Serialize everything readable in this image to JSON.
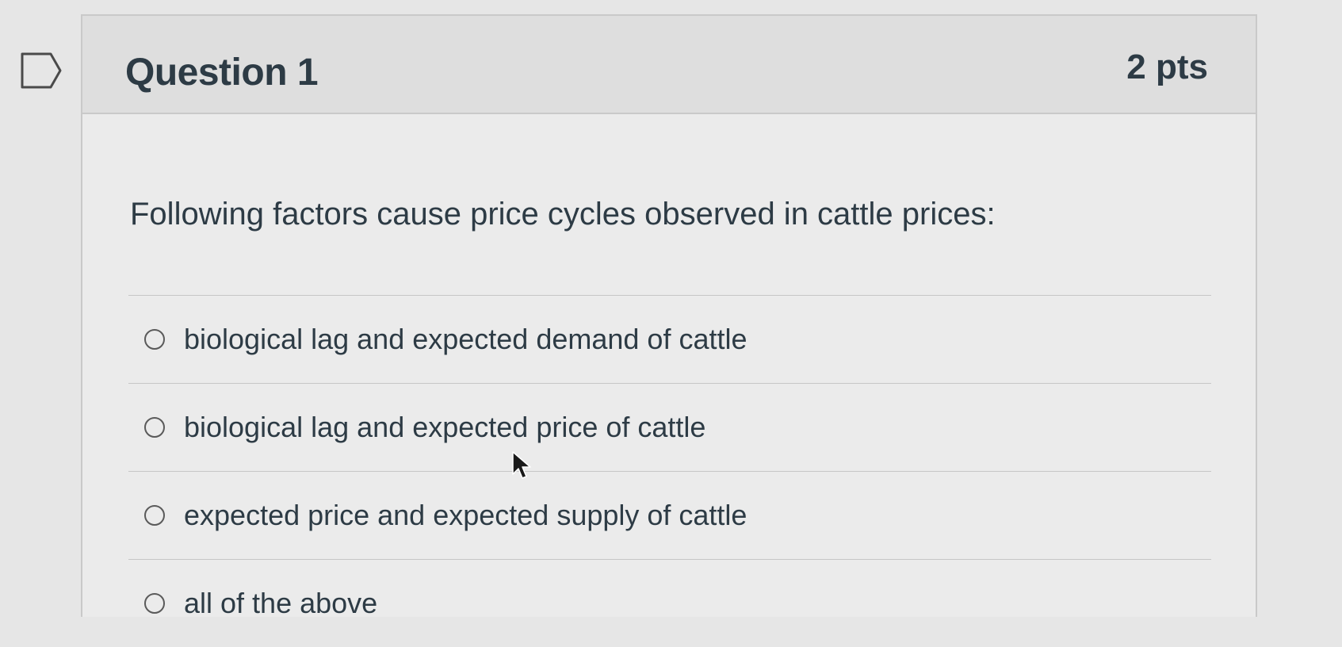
{
  "question": {
    "title": "Question 1",
    "points": "2 pts",
    "text": "Following factors cause price cycles observed in cattle prices:"
  },
  "answers": [
    {
      "label": "biological lag and expected demand of cattle",
      "selected": false
    },
    {
      "label": "biological lag and expected price of cattle",
      "selected": false
    },
    {
      "label": "expected price and expected supply of cattle",
      "selected": false
    },
    {
      "label": "all of the above",
      "selected": false
    }
  ],
  "icons": {
    "bookmark": "bookmark-flag-icon",
    "cursor": "mouse-pointer-icon"
  },
  "colors": {
    "background": "#e6e6e6",
    "header": "#dedede",
    "text": "#2d3b45",
    "border": "#c9c9c9"
  }
}
